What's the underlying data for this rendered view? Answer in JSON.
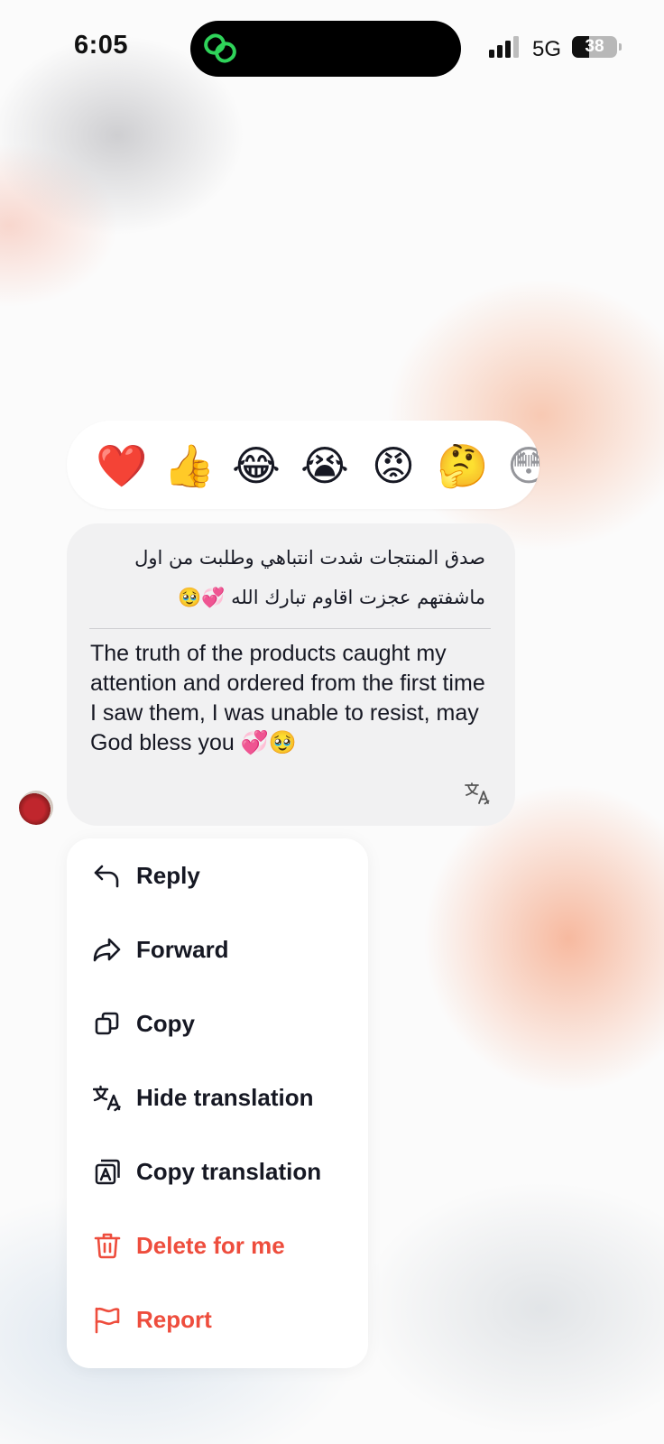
{
  "status_bar": {
    "time": "6:05",
    "network": "5G",
    "battery": "38",
    "battery_level_percent": 38
  },
  "reactions": [
    {
      "emoji": "❤️",
      "name": "heart"
    },
    {
      "emoji": "👍",
      "name": "thumbs-up"
    },
    {
      "emoji": "😂",
      "name": "tears-of-joy"
    },
    {
      "emoji": "😭",
      "name": "loudly-crying"
    },
    {
      "emoji": "😡",
      "name": "angry"
    },
    {
      "emoji": "🤔",
      "name": "thinking"
    },
    {
      "emoji": "😳",
      "name": "flushed"
    }
  ],
  "message": {
    "original_line1": "صدق المنتجات شدت انتباهي وطلبت من اول",
    "original_line2": "ماشفتهم عجزت اقاوم تبارك الله 💞🥹",
    "translation": "The truth of the products caught my attention and ordered from the first time I saw them, I was unable to resist, may God bless you 💞🥹"
  },
  "menu": {
    "items": [
      {
        "label": "Reply",
        "icon": "reply-icon"
      },
      {
        "label": "Forward",
        "icon": "forward-icon"
      },
      {
        "label": "Copy",
        "icon": "copy-icon"
      },
      {
        "label": "Hide translation",
        "icon": "translate-icon"
      },
      {
        "label": "Copy translation",
        "icon": "copy-translation-icon"
      },
      {
        "label": "Delete for me",
        "icon": "trash-icon"
      },
      {
        "label": "Report",
        "icon": "flag-icon"
      }
    ]
  },
  "colors": {
    "danger": "#ee4d3d",
    "text": "#161823",
    "bubble": "#f1f1f2",
    "app_icon": "#2fd35a"
  }
}
